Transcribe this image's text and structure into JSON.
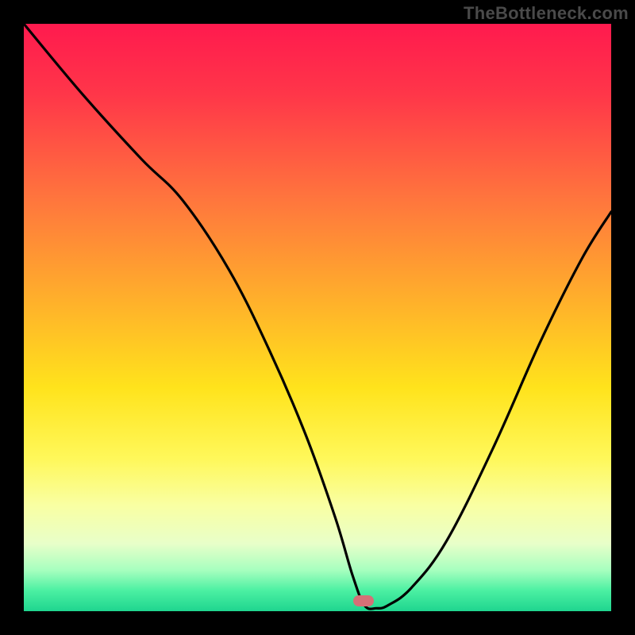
{
  "watermark": "TheBottleneck.com",
  "gradient_stops": [
    {
      "offset": 0.0,
      "color": "#ff1a4e"
    },
    {
      "offset": 0.12,
      "color": "#ff3649"
    },
    {
      "offset": 0.3,
      "color": "#ff763d"
    },
    {
      "offset": 0.48,
      "color": "#ffb32a"
    },
    {
      "offset": 0.62,
      "color": "#ffe31c"
    },
    {
      "offset": 0.74,
      "color": "#fff85a"
    },
    {
      "offset": 0.82,
      "color": "#f9ffa3"
    },
    {
      "offset": 0.885,
      "color": "#e8ffc9"
    },
    {
      "offset": 0.93,
      "color": "#a7ffbf"
    },
    {
      "offset": 0.965,
      "color": "#4bf0a2"
    },
    {
      "offset": 1.0,
      "color": "#1fd58f"
    }
  ],
  "marker": {
    "x_pct": 57.8,
    "y_pct": 98.2,
    "color": "#d57077"
  },
  "chart_data": {
    "type": "line",
    "title": "",
    "xlabel": "",
    "ylabel": "",
    "xlim": [
      0,
      100
    ],
    "ylim": [
      0,
      100
    ],
    "grid": false,
    "legend": false,
    "annotations": [
      "TheBottleneck.com"
    ],
    "series": [
      {
        "name": "bottleneck-curve",
        "x": [
          0,
          10,
          20,
          27,
          35,
          42,
          48,
          53,
          56,
          58,
          60,
          62,
          66,
          72,
          80,
          88,
          95,
          100
        ],
        "y_value": [
          100,
          88,
          77,
          70,
          58,
          44,
          30,
          16,
          6,
          1,
          0.5,
          1,
          4,
          12,
          28,
          46,
          60,
          68
        ],
        "note": "y_value is percentage height from bottom (0=bottom green band, 100=top red band). Curve descends steeply from upper-left with a slight knee around x≈27, reaches a flat minimum near x≈57–62 touching the bottom, then rises toward the right edge ending around y≈68."
      }
    ],
    "background": {
      "description": "Vertical gradient fill inside plot area representing bottleneck severity: red at top through orange, yellow, pale yellow, to green at bottom.",
      "stops_ref": "gradient_stops"
    },
    "marker_point": {
      "x": 57.8,
      "y": 1.8,
      "shape": "rounded-rect",
      "color": "#d57077"
    }
  }
}
